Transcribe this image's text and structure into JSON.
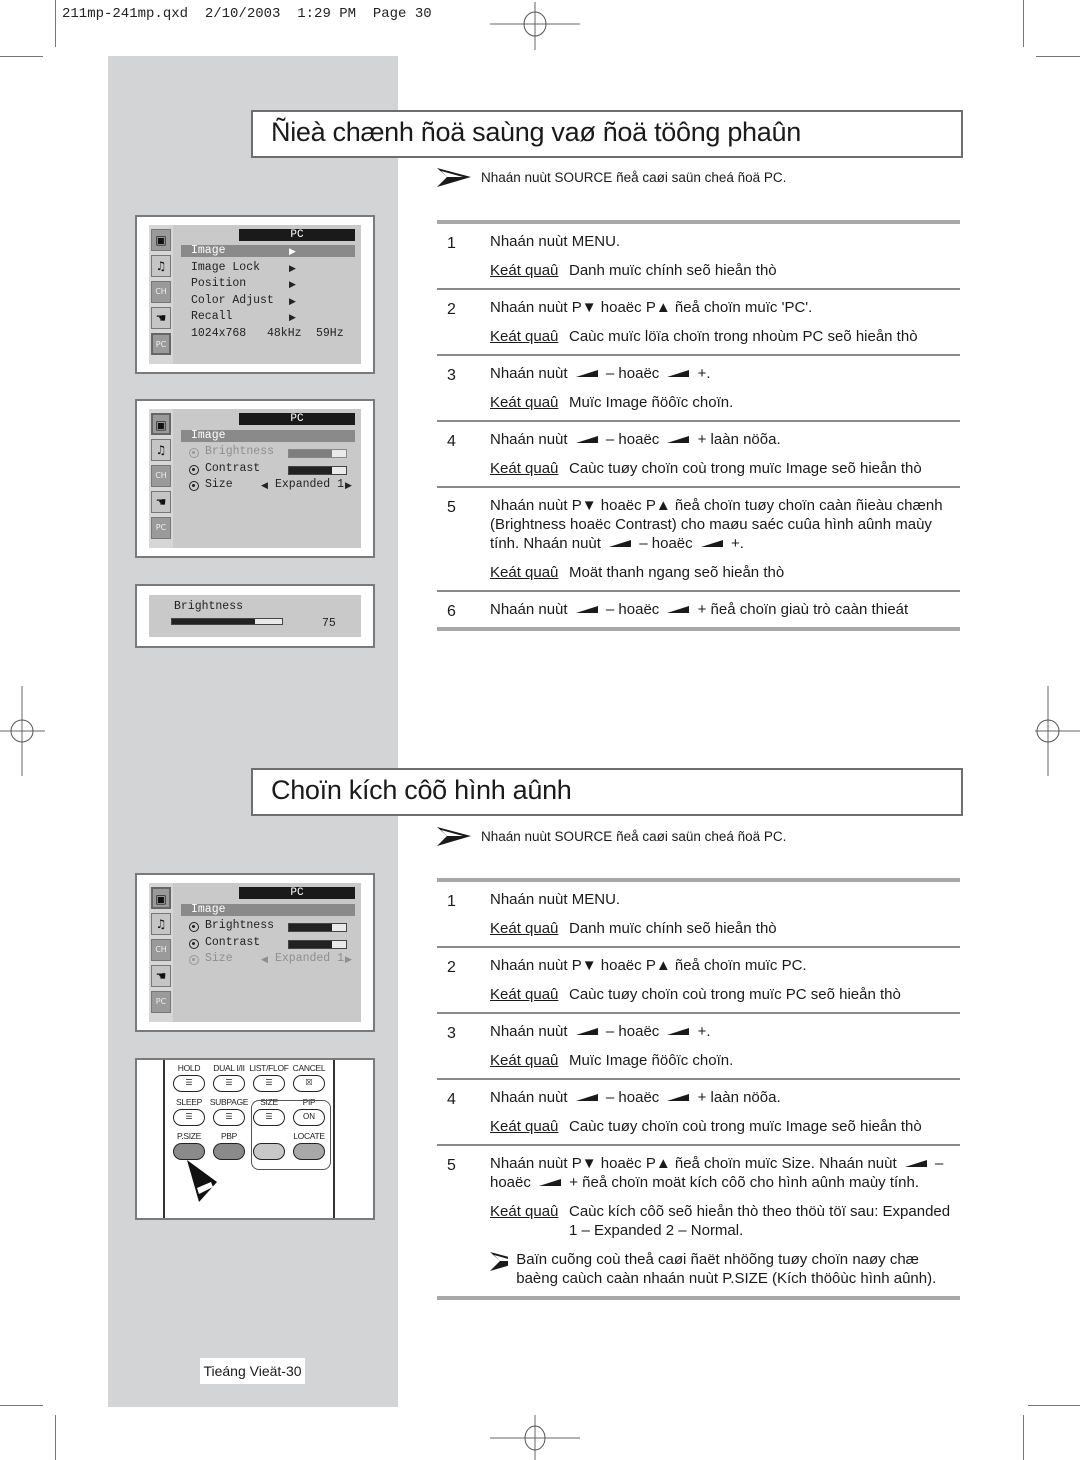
{
  "print_slug": "211mp-241mp.qxd  2/10/2003  1:29 PM  Page 30",
  "sections": [
    {
      "title": "Ñieà chænh ñoä saùng vaø ñoä töông phaûn",
      "source_note": "Nhaán nuùt SOURCE ñeå caøi saün cheá ñoä PC.",
      "steps": [
        {
          "num": "1",
          "instruction": "Nhaán nuùt MENU.",
          "result_label": "Keát quaû",
          "result": "Danh muïc chính seõ hieån thò"
        },
        {
          "num": "2",
          "instruction": [
            "Nhaán nuùt P",
            "▼",
            " hoaëc P",
            "▲",
            " ñeå choïn muïc 'PC'."
          ],
          "result_label": "Keát quaû",
          "result": "Caùc muïc löïa choïn trong nhoùm PC seõ hieån thò"
        },
        {
          "num": "3",
          "instruction": [
            "Nhaán nuùt ",
            "vol",
            " – hoaëc ",
            "vol",
            " +."
          ],
          "result_label": "Keát quaû",
          "result": "Muïc Image ñöôïc choïn."
        },
        {
          "num": "4",
          "instruction": [
            "Nhaán nuùt ",
            "vol",
            " – hoaëc ",
            "vol",
            " + laàn nöõa."
          ],
          "result_label": "Keát quaû",
          "result": "Caùc tuøy choïn coù trong muïc Image seõ hieån thò"
        },
        {
          "num": "5",
          "instruction": [
            "Nhaán nuùt P",
            "▼",
            " hoaëc P",
            "▲",
            " ñeå choïn tuøy choïn caàn ñieàu chænh (Brightness hoaëc Contrast) cho maøu saéc cuûa hình aûnh maùy tính. Nhaán nuùt ",
            "vol",
            " – hoaëc ",
            "vol",
            " +."
          ],
          "result_label": "Keát quaû",
          "result": "Moät thanh ngang seõ hieån thò"
        },
        {
          "num": "6",
          "instruction": [
            "Nhaán nuùt ",
            "vol",
            " – hoaëc ",
            "vol",
            " + ñeå choïn giaù trò caàn thieát"
          ]
        }
      ]
    },
    {
      "title": "Choïn kích côõ hình aûnh",
      "source_note": "Nhaán nuùt SOURCE ñeå caøi saün cheá ñoä PC.",
      "steps": [
        {
          "num": "1",
          "instruction": "Nhaán nuùt MENU.",
          "result_label": "Keát quaû",
          "result": "Danh muïc chính seõ hieån thò"
        },
        {
          "num": "2",
          "instruction": [
            "Nhaán nuùt P",
            "▼",
            " hoaëc P",
            "▲",
            " ñeå choïn muïc PC."
          ],
          "result_label": "Keát quaû",
          "result": "Caùc tuøy choïn coù trong muïc PC seõ hieån thò"
        },
        {
          "num": "3",
          "instruction": [
            "Nhaán nuùt ",
            "vol",
            " – hoaëc ",
            "vol",
            " +."
          ],
          "result_label": "Keát quaû",
          "result": "Muïc Image ñöôïc choïn."
        },
        {
          "num": "4",
          "instruction": [
            "Nhaán nuùt ",
            "vol",
            " – hoaëc ",
            "vol",
            " + laàn nöõa."
          ],
          "result_label": "Keát quaû",
          "result": "Caùc tuøy choïn coù trong muïc Image seõ hieån thò"
        },
        {
          "num": "5",
          "instruction": [
            "Nhaán nuùt P",
            "▼",
            " hoaëc P",
            "▲",
            " ñeå choïn muïc Size. Nhaán nuùt ",
            "vol",
            " – hoaëc ",
            "vol",
            " + ñeå choïn moät kích côõ cho hình aûnh maùy tính."
          ],
          "result_label": "Keát quaû",
          "result": "Caùc kích côõ seõ hieån thò theo thöù töï sau: Expanded 1 – Expanded 2 – Normal.",
          "tip": "Baïn cuõng coù theå caøi ñaët nhöõng tuøy choïn naøy chæ baèng caùch caàn nhaán nuùt P.SIZE (Kích thöôùc hình aûnh)."
        }
      ]
    }
  ],
  "osd_main": {
    "header": "PC",
    "items": [
      {
        "label": "Image",
        "arrow": "▶",
        "selected": true
      },
      {
        "label": "Image Lock",
        "arrow": "▶"
      },
      {
        "label": "Position",
        "arrow": "▶"
      },
      {
        "label": "Color Adjust",
        "arrow": "▶"
      },
      {
        "label": "Recall",
        "arrow": "▶"
      }
    ],
    "resolution": "1024x768",
    "h_freq": "48kHz",
    "v_freq": "59Hz",
    "side_icons": [
      "tv-picture-icon",
      "music-note-icon",
      "channel-icon",
      "setup-hand-icon",
      "pc-icon"
    ]
  },
  "osd_image_brightness": {
    "header": "PC",
    "title": "Image",
    "brightness_label": "Brightness",
    "contrast_label": "Contrast",
    "size_label": "Size",
    "size_value": "Expanded 1",
    "brightness_level": 0.75,
    "contrast_level": 0.75,
    "active": "brightness"
  },
  "osd_brightness_bar": {
    "label": "Brightness",
    "value": "75",
    "level": 0.75
  },
  "osd_image_size": {
    "header": "PC",
    "title": "Image",
    "brightness_label": "Brightness",
    "contrast_label": "Contrast",
    "size_label": "Size",
    "size_value": "Expanded 1",
    "brightness_level": 0.75,
    "contrast_level": 0.75,
    "active": "size"
  },
  "remote": {
    "row1": [
      "HOLD",
      "DUAL I/II",
      "LIST/FLOF",
      "CANCEL"
    ],
    "row2": [
      "SLEEP",
      "SUBPAGE",
      "SIZE",
      "PIP"
    ],
    "row3": [
      "P.SIZE",
      "PBP",
      "",
      "LOCATE"
    ],
    "pip_button_text": "ON"
  },
  "footer": "Tieáng Vieät-30"
}
